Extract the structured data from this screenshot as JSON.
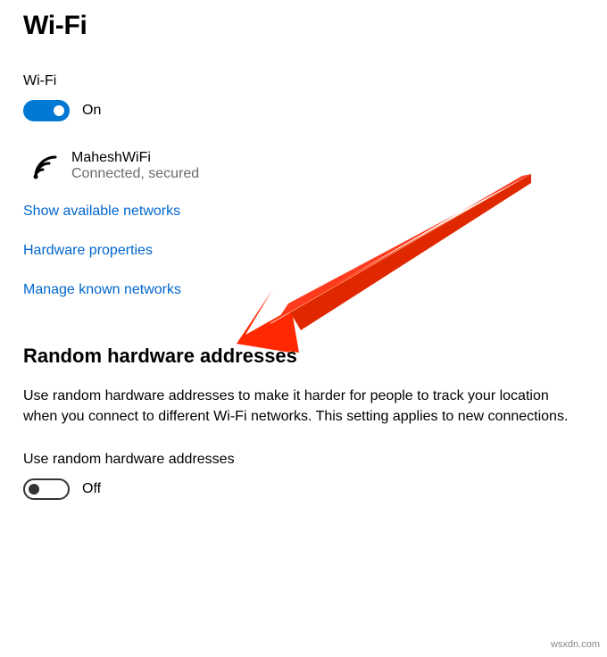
{
  "page": {
    "title": "Wi-Fi"
  },
  "wifi": {
    "section_label": "Wi-Fi",
    "toggle_state": "On",
    "toggle_on": true
  },
  "network": {
    "name": "MaheshWiFi",
    "status": "Connected, secured"
  },
  "links": {
    "show_available": "Show available networks",
    "hardware_properties": "Hardware properties",
    "manage_known": "Manage known networks"
  },
  "random_hw": {
    "heading": "Random hardware addresses",
    "description": "Use random hardware addresses to make it harder for people to track your location when you connect to different Wi-Fi networks. This setting applies to new connections.",
    "toggle_label": "Use random hardware addresses",
    "toggle_state": "Off",
    "toggle_on": false
  },
  "watermark": "wsxdn.com",
  "colors": {
    "accent": "#0078d4",
    "link": "#0066cc",
    "muted": "#6b6b6b",
    "arrow": "#ff3b1f"
  }
}
